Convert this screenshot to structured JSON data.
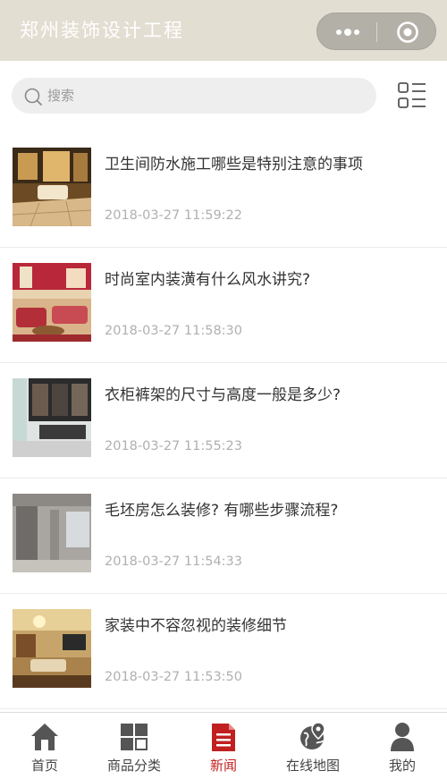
{
  "header": {
    "title": "郑州装饰设计工程"
  },
  "search": {
    "placeholder": "搜索"
  },
  "news": [
    {
      "title": "卫生间防水施工哪些是特别注意的事项",
      "date": "2018-03-27 11:59:22"
    },
    {
      "title": "时尚室内装潢有什么风水讲究?",
      "date": "2018-03-27 11:58:30"
    },
    {
      "title": "衣柜裤架的尺寸与高度一般是多少?",
      "date": "2018-03-27 11:55:23"
    },
    {
      "title": "毛坯房怎么装修? 有哪些步骤流程?",
      "date": "2018-03-27 11:54:33"
    },
    {
      "title": "家装中不容忽视的装修细节",
      "date": "2018-03-27 11:53:50"
    }
  ],
  "tabs": [
    {
      "label": "首页",
      "icon": "home-icon"
    },
    {
      "label": "商品分类",
      "icon": "category-grid-icon"
    },
    {
      "label": "新闻",
      "icon": "news-document-icon",
      "active": true
    },
    {
      "label": "在线地图",
      "icon": "map-pin-globe-icon"
    },
    {
      "label": "我的",
      "icon": "user-icon"
    }
  ],
  "colors": {
    "header_bg": "#e3ded2",
    "active_tab": "#c0201f",
    "inactive_icon": "#555555"
  }
}
